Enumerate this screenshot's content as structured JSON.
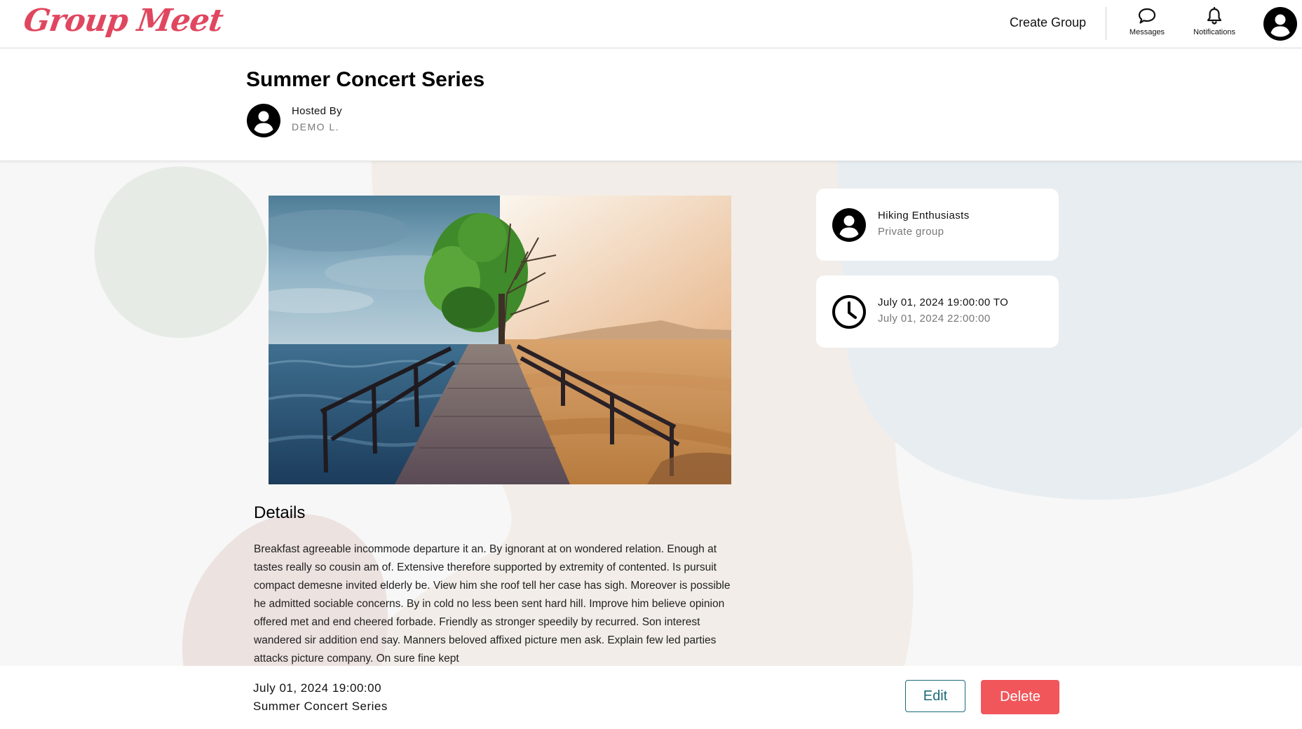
{
  "app": {
    "logo_text": "Group Meet"
  },
  "nav": {
    "create_group": "Create Group",
    "messages_label": "Messages",
    "notifications_label": "Notifications",
    "avatar_icon": "user-avatar-icon"
  },
  "event": {
    "title": "Summer Concert Series",
    "hosted_by_label": "Hosted By",
    "host_name": "DEMO L.",
    "image_icon": "event-photo"
  },
  "details": {
    "heading": "Details",
    "text": "Breakfast agreeable incommode departure it an. By ignorant at on wondered relation. Enough at tastes really so cousin am of. Extensive therefore supported by extremity of contented. Is pursuit compact demesne invited elderly be. View him she roof tell her case has sigh. Moreover is possible he admitted sociable concerns. By in cold no less been sent hard hill. Improve him believe opinion offered met and end cheered forbade. Friendly as stronger speedily by recurred. Son interest wandered sir addition end say. Manners beloved affixed picture men ask. Explain few led parties attacks picture company. On sure fine kept"
  },
  "group_card": {
    "name": "Hiking Enthusiasts",
    "privacy": "Private group"
  },
  "time_card": {
    "start": "July 01, 2024 19:00:00 TO",
    "end": "July 01, 2024 22:00:00"
  },
  "footer": {
    "date": "July 01, 2024 19:00:00",
    "title": "Summer Concert Series",
    "edit_label": "Edit",
    "delete_label": "Delete"
  },
  "colors": {
    "brand": "#e0475f",
    "edit_accent": "#1a6a7a",
    "delete_bg": "#f0565a"
  }
}
